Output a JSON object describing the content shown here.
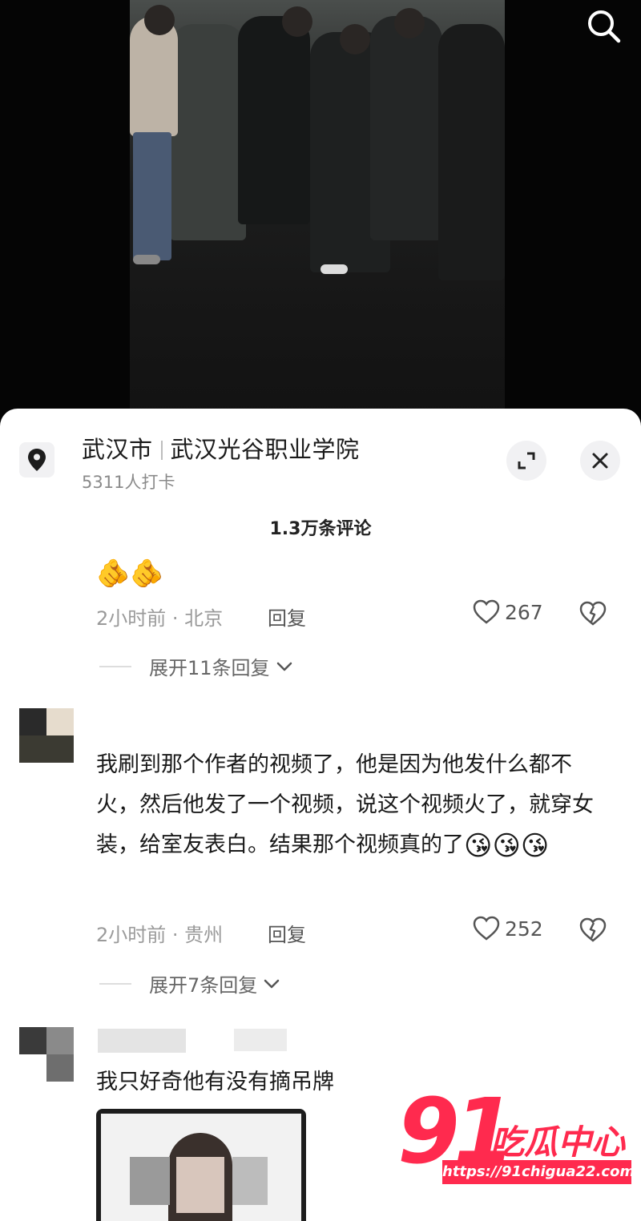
{
  "location": {
    "city": "武汉市",
    "place": "武汉光谷职业学院",
    "checkins": "5311人打卡"
  },
  "comments_header": "1.3万条评论",
  "reply_label": "回复",
  "comments": [
    {
      "emoji": "🫵🫵",
      "time": "2小时前",
      "region": "北京",
      "likes": "267",
      "expand": "展开11条回复"
    },
    {
      "text": "我刷到那个作者的视频了，他是因为他发什么都不火，然后他发了一个视频，说这个视频火了，就穿女装，给室友表白。结果那个视频真的了",
      "emoji": "😘😘😘",
      "time": "2小时前",
      "region": "贵州",
      "likes": "252",
      "expand": "展开7条回复"
    },
    {
      "text": "我只好奇他有没有摘吊牌"
    }
  ],
  "watermark": {
    "number": "91",
    "name": "吃瓜中心",
    "url": "https://91chigua22.com"
  },
  "colors": {
    "watermark": "#ff2a4e",
    "sheet_bg": "#ffffff",
    "muted_text": "#9a9a9a"
  },
  "icons": [
    "search-icon",
    "location-pin-icon",
    "expand-icon",
    "close-icon",
    "heart-icon",
    "dislike-heart-icon",
    "chevron-down-icon"
  ]
}
